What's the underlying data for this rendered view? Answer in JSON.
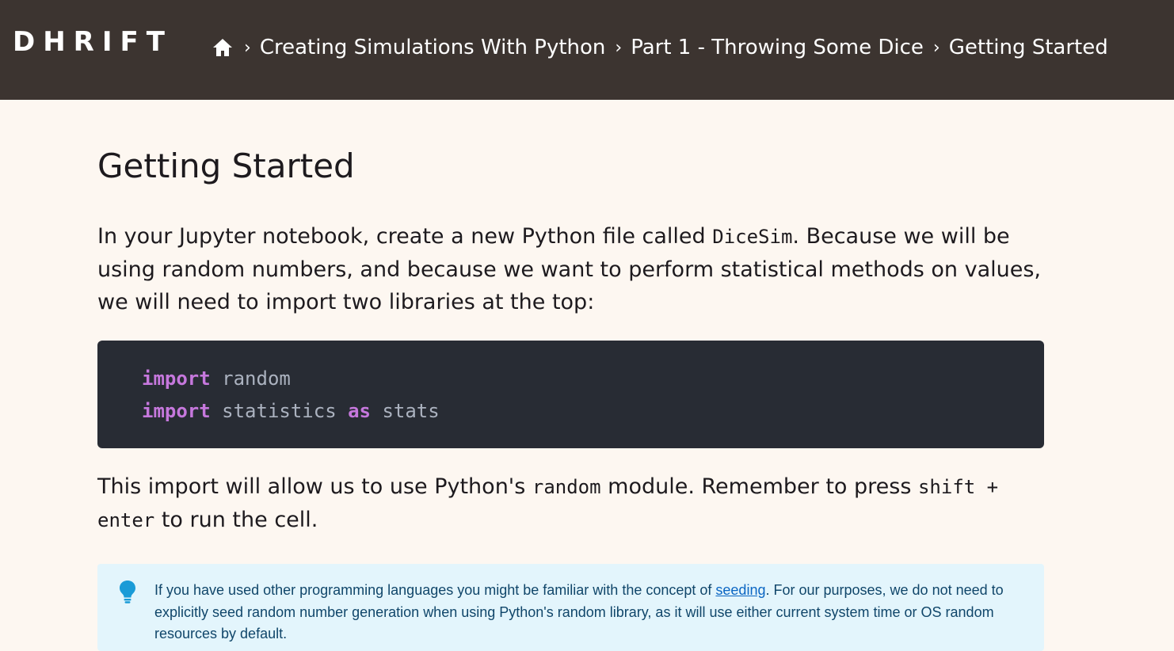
{
  "header": {
    "logo": "DHRIFT",
    "breadcrumb": [
      {
        "label": "Creating Simulations With Python"
      },
      {
        "label": "Part 1 - Throwing Some Dice"
      },
      {
        "label": "Getting Started"
      }
    ],
    "separator": "›",
    "home_icon": "home-icon"
  },
  "page": {
    "title": "Getting Started",
    "intro_before": "In your Jupyter notebook, create a new Python file called ",
    "intro_code": "DiceSim",
    "intro_after": ". Because we will be using random numbers, and because we want to perform statistical methods on values, we will need to import two libraries at the top:",
    "code": {
      "line1_kw": "import",
      "line1_rest": " random",
      "line2_kw": "import",
      "line2_mid": " statistics ",
      "line2_kw2": "as",
      "line2_rest": " stats"
    },
    "p2_a": "This import will allow us to use Python's ",
    "p2_code1": "random",
    "p2_b": " module. Remember to press ",
    "p2_code2": "shift + enter",
    "p2_c": " to run the cell.",
    "tip": {
      "icon": "lightbulb-icon",
      "before": "If you have used other programming languages you might be familiar with the concept of ",
      "link": "seeding",
      "after": ". For our purposes, we do not need to explicitly seed random number generation when using Python's random library, as it will use either current system time or OS random resources by default."
    }
  },
  "colors": {
    "header_bg": "#3c3430",
    "page_bg": "#fdf7f1",
    "code_bg": "#282c34",
    "keyword": "#c678dd",
    "tip_bg": "#e3f5fc",
    "tip_icon": "#1a9bd7"
  }
}
